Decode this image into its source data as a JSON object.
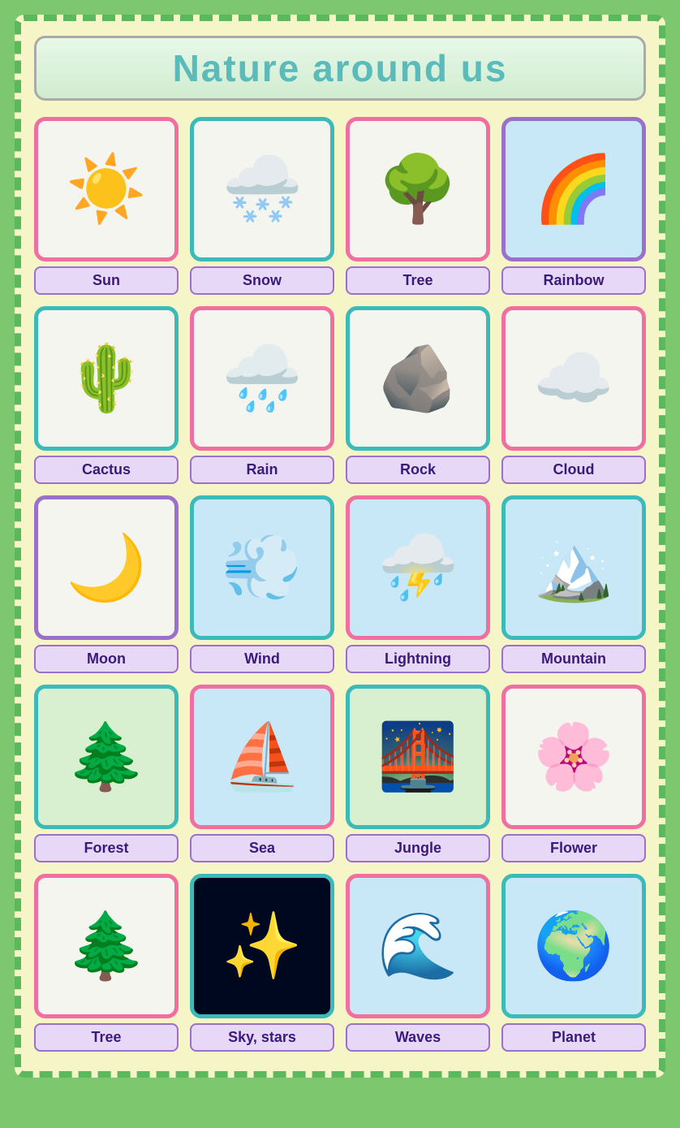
{
  "title": "Nature around us",
  "cards": [
    {
      "id": "sun",
      "label": "Sun",
      "emoji": "☀️",
      "border": "border-pink",
      "bg": "bg-light"
    },
    {
      "id": "snow",
      "label": "Snow",
      "emoji": "🌨️",
      "border": "border-teal",
      "bg": "bg-light"
    },
    {
      "id": "tree1",
      "label": "Tree",
      "emoji": "🌳",
      "border": "border-pink",
      "bg": "bg-light"
    },
    {
      "id": "rainbow",
      "label": "Rainbow",
      "emoji": "🌈",
      "border": "border-purple",
      "bg": "bg-sky"
    },
    {
      "id": "cactus",
      "label": "Cactus",
      "emoji": "🌵",
      "border": "border-teal",
      "bg": "bg-light"
    },
    {
      "id": "rain",
      "label": "Rain",
      "emoji": "🌧️",
      "border": "border-pink",
      "bg": "bg-light"
    },
    {
      "id": "rock",
      "label": "Rock",
      "emoji": "🪨",
      "border": "border-teal",
      "bg": "bg-light"
    },
    {
      "id": "cloud",
      "label": "Cloud",
      "emoji": "☁️",
      "border": "border-pink",
      "bg": "bg-light"
    },
    {
      "id": "moon",
      "label": "Moon",
      "emoji": "🌙",
      "border": "border-purple",
      "bg": "bg-light"
    },
    {
      "id": "wind",
      "label": "Wind",
      "emoji": "💨",
      "border": "border-teal",
      "bg": "bg-sky"
    },
    {
      "id": "lightning",
      "label": "Lightning",
      "emoji": "⛈️",
      "border": "border-pink",
      "bg": "bg-sky"
    },
    {
      "id": "mountain",
      "label": "Mountain",
      "emoji": "🏔️",
      "border": "border-teal",
      "bg": "bg-sky"
    },
    {
      "id": "forest",
      "label": "Forest",
      "emoji": "🌲",
      "border": "border-teal",
      "bg": "bg-green"
    },
    {
      "id": "sea",
      "label": "Sea",
      "emoji": "⛵",
      "border": "border-pink",
      "bg": "bg-sky"
    },
    {
      "id": "jungle",
      "label": "Jungle",
      "emoji": "🌉",
      "border": "border-teal",
      "bg": "bg-green"
    },
    {
      "id": "flower",
      "label": "Flower",
      "emoji": "🌸",
      "border": "border-pink",
      "bg": "bg-light"
    },
    {
      "id": "tree2",
      "label": "Tree",
      "emoji": "🌲",
      "border": "border-pink",
      "bg": "bg-light"
    },
    {
      "id": "sky",
      "label": "Sky,  stars",
      "emoji": "✨",
      "border": "border-teal",
      "bg": "bg-night"
    },
    {
      "id": "waves",
      "label": "Waves",
      "emoji": "🌊",
      "border": "border-pink",
      "bg": "bg-sky"
    },
    {
      "id": "planet",
      "label": "Planet",
      "emoji": "🌍",
      "border": "border-teal",
      "bg": "bg-sky"
    }
  ]
}
